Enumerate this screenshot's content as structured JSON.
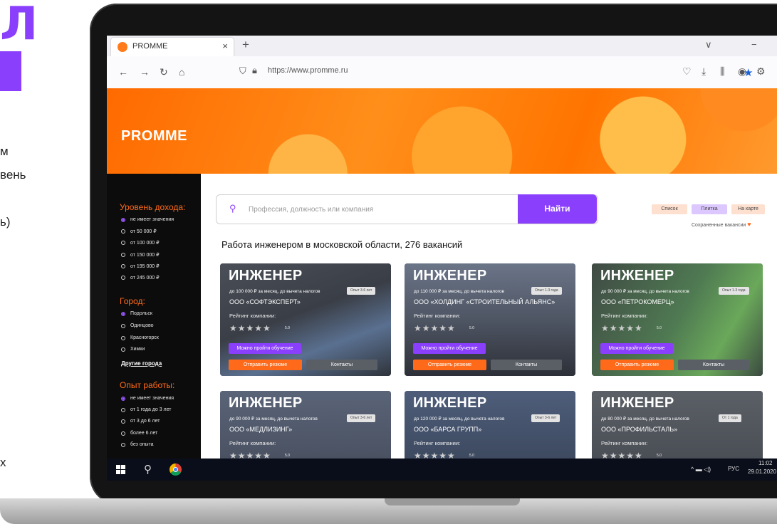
{
  "slide": {
    "big_letter": "Л",
    "lines": [
      "м",
      "вень",
      "ь)",
      "х"
    ]
  },
  "browser": {
    "tab_title": "PROMME",
    "tab_close": "×",
    "new_tab": "+",
    "window_menu": "∨",
    "window_minimize": "−",
    "url": "https://www.promme.ru"
  },
  "hero": {
    "title": "PROMME"
  },
  "sidebar": {
    "income_heading": "Уровень дохода:",
    "income_options": [
      "не имеет значения",
      "от 50 000 ₽",
      "от 100 000 ₽",
      "от 150 000 ₽",
      "от 195 000 ₽",
      "от 245 000 ₽"
    ],
    "city_heading": "Город:",
    "city_options": [
      "Подольск",
      "Одинцово",
      "Красногорск",
      "Химки"
    ],
    "city_more": "Другие города",
    "experience_heading": "Опыт работы:",
    "experience_options": [
      "не имеет значения",
      "от 1 года до 3 лет",
      "от 3 до 6 лет",
      "более 6 лет",
      "без опыта"
    ]
  },
  "search": {
    "placeholder": "Профессия, должность или компания",
    "button": "Найти"
  },
  "view_modes": {
    "list": "Список",
    "tiles": "Плитка",
    "map": "На карте",
    "saved": "Сохраненные вакансии"
  },
  "results_title": "Работа инженером в московской области, 276 вакансий",
  "cards": [
    {
      "title": "ИНЖЕНЕР",
      "salary": "до 100 000 ₽ за месяц, до вычета налогов",
      "experience": "Опыт 3-6 лет",
      "company": "ООО «СОФТЭКСПЕРТ»",
      "rating_label": "Рейтинг компании:",
      "stars": "★★★★★",
      "score": "5.0",
      "learn": "Можно пройти обучение",
      "resume": "Отправить резюме",
      "contacts": "Контакты"
    },
    {
      "title": "ИНЖЕНЕР",
      "salary": "до 110 000 ₽ за месяц, до вычета налогов",
      "experience": "Опыт 1-3 года",
      "company": "ООО «ХОЛДИНГ «СТРОИТЕЛЬНЫЙ АЛЬЯНС»",
      "rating_label": "Рейтинг компании:",
      "stars": "★★★★★",
      "score": "5.0",
      "learn": "Можно пройти обучение",
      "resume": "Отправить резюме",
      "contacts": "Контакты"
    },
    {
      "title": "ИНЖЕНЕР",
      "salary": "до 90 000 ₽ за месяц, до вычета налогов",
      "experience": "Опыт 1-3 года",
      "company": "ООО «ПЕТРОКОМЕРЦ»",
      "rating_label": "Рейтинг компании:",
      "stars": "★★★★★",
      "score": "5.0",
      "learn": "Можно пройти обучение",
      "resume": "Отправить резюме",
      "contacts": "Контакты"
    },
    {
      "title": "ИНЖЕНЕР",
      "salary": "до 90 000 ₽ за месяц, до вычета налогов",
      "experience": "Опыт 3-6 лет",
      "company": "ООО «МЕДЛИЗИНГ»",
      "rating_label": "Рейтинг компании:",
      "stars": "★★★★★",
      "score": "5.0"
    },
    {
      "title": "ИНЖЕНЕР",
      "salary": "до 120 000 ₽ за месяц, до вычета налогов",
      "experience": "Опыт 3-6 лет",
      "company": "ООО «БАРСА ГРУПП»",
      "rating_label": "Рейтинг компании:",
      "stars": "★★★★★",
      "score": "5.0"
    },
    {
      "title": "ИНЖЕНЕР",
      "salary": "до 80 000 ₽ за месяц, до вычета налогов",
      "experience": "От 1 года",
      "company": "ООО «ПРОФИЛЬСТАЛЬ»",
      "rating_label": "Рейтинг компании:",
      "stars": "★★★★★",
      "score": "5.0"
    }
  ],
  "taskbar": {
    "tray_icons": "^ ▬ ◁)",
    "language": "РУС",
    "time": "11:02",
    "date": "29.01.2020"
  },
  "colors": {
    "accent_purple": "#8a3ffc",
    "accent_orange": "#ff6a1a",
    "card_bg": "#3a3f46"
  }
}
